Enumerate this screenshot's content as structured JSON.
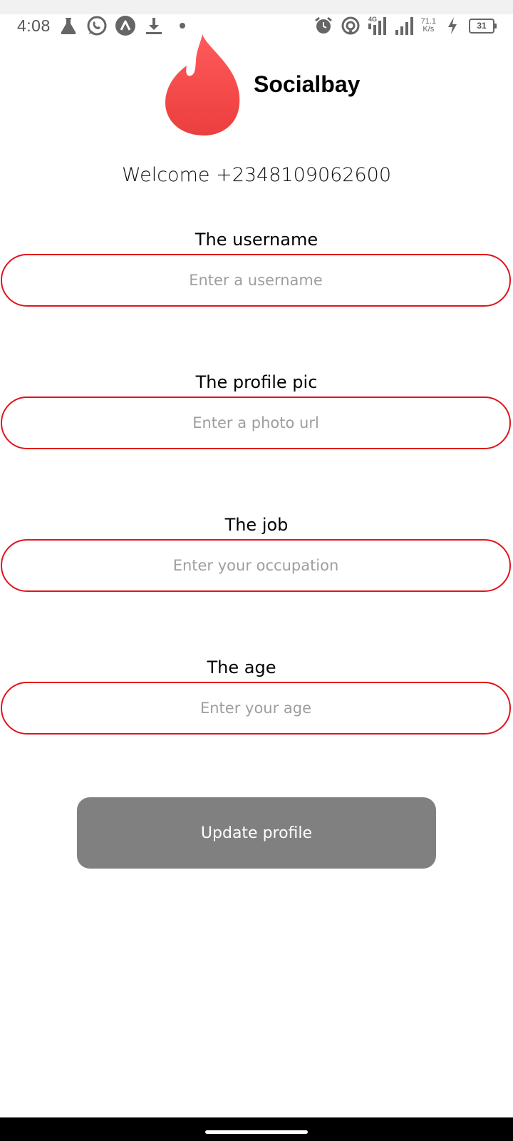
{
  "status_bar": {
    "time": "4:08",
    "network_type": "4G",
    "speed_value": "71.1",
    "speed_unit": "K/s",
    "battery": "31",
    "icons": [
      "flask-icon",
      "whatsapp-icon",
      "app-icon",
      "download-icon",
      "dot-icon",
      "alarm-icon",
      "hotspot-icon",
      "signal-icon",
      "signal-icon",
      "charging-icon",
      "battery-icon"
    ]
  },
  "header": {
    "app_name": "Socialbay",
    "logo_color": "#f44a4a"
  },
  "welcome": "Welcome +2348109062600",
  "form": {
    "username": {
      "label": "The username",
      "placeholder": "Enter a username",
      "value": ""
    },
    "profile_pic": {
      "label": "The profile pic",
      "placeholder": "Enter a photo url",
      "value": ""
    },
    "job": {
      "label": "The job",
      "placeholder": "Enter your occupation",
      "value": ""
    },
    "age": {
      "label": "The age",
      "placeholder": "Enter your age",
      "value": ""
    },
    "border_color": "#e3131b"
  },
  "update_button": {
    "label": "Update profile",
    "color": "#808080"
  }
}
